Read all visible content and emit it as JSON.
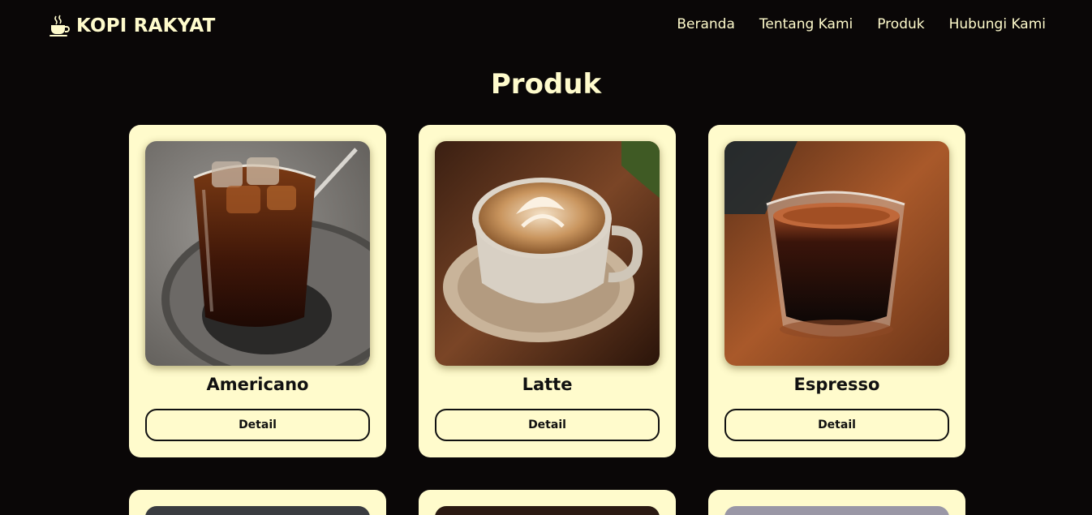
{
  "brand": {
    "name": "KOPI RAKYAT",
    "icon": "coffee-cup-icon"
  },
  "nav": {
    "items": [
      {
        "label": "Beranda"
      },
      {
        "label": "Tentang Kami"
      },
      {
        "label": "Produk"
      },
      {
        "label": "Hubungi Kami"
      }
    ]
  },
  "products": {
    "title": "Produk",
    "items": [
      {
        "name": "Americano",
        "button": "Detail"
      },
      {
        "name": "Latte",
        "button": "Detail"
      },
      {
        "name": "Espresso",
        "button": "Detail"
      }
    ]
  },
  "colors": {
    "background": "#0a0707",
    "accent": "#fffbcc",
    "text_dark": "#111111"
  }
}
